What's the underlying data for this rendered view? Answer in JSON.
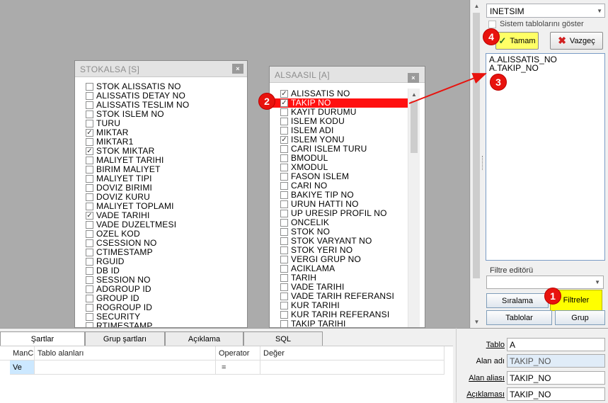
{
  "stokalsa": {
    "title": "STOKALSA [S]",
    "close": "×",
    "fields": [
      {
        "name": "STOK ALISSATIS NO",
        "checked": false
      },
      {
        "name": "ALISSATIS DETAY NO",
        "checked": false
      },
      {
        "name": "ALISSATIS TESLIM NO",
        "checked": false
      },
      {
        "name": "STOK ISLEM NO",
        "checked": false
      },
      {
        "name": "TURU",
        "checked": false
      },
      {
        "name": "MIKTAR",
        "checked": true
      },
      {
        "name": "MIKTAR1",
        "checked": false
      },
      {
        "name": "STOK MIKTAR",
        "checked": true
      },
      {
        "name": "MALIYET TARIHI",
        "checked": false
      },
      {
        "name": "BIRIM MALIYET",
        "checked": false
      },
      {
        "name": "MALIYET TIPI",
        "checked": false
      },
      {
        "name": "DOVIZ BIRIMI",
        "checked": false
      },
      {
        "name": "DOVIZ KURU",
        "checked": false
      },
      {
        "name": "MALIYET TOPLAMI",
        "checked": false
      },
      {
        "name": "VADE TARIHI",
        "checked": true
      },
      {
        "name": "VADE DUZELTMESI",
        "checked": false
      },
      {
        "name": "OZEL KOD",
        "checked": false
      },
      {
        "name": "CSESSION NO",
        "checked": false
      },
      {
        "name": "CTIMESTAMP",
        "checked": false
      },
      {
        "name": "RGUID",
        "checked": false
      },
      {
        "name": "DB ID",
        "checked": false
      },
      {
        "name": "SESSION NO",
        "checked": false
      },
      {
        "name": "ADGROUP ID",
        "checked": false
      },
      {
        "name": "GROUP ID",
        "checked": false
      },
      {
        "name": "ROGROUP ID",
        "checked": false
      },
      {
        "name": "SECURITY",
        "checked": false
      },
      {
        "name": "RTIMESTAMP",
        "checked": false
      }
    ]
  },
  "alsaasil": {
    "title": "ALSAASIL [A]",
    "close": "×",
    "fields": [
      {
        "name": "ALISSATIS NO",
        "checked": true
      },
      {
        "name": "TAKIP NO",
        "checked": true,
        "highlighted": true
      },
      {
        "name": "KAYIT DURUMU",
        "checked": false
      },
      {
        "name": "ISLEM KODU",
        "checked": false
      },
      {
        "name": "ISLEM ADI",
        "checked": false
      },
      {
        "name": "ISLEM YONU",
        "checked": true
      },
      {
        "name": "CARI ISLEM TURU",
        "checked": false
      },
      {
        "name": "BMODUL",
        "checked": false
      },
      {
        "name": "XMODUL",
        "checked": false
      },
      {
        "name": "FASON ISLEM",
        "checked": false
      },
      {
        "name": "CARI NO",
        "checked": false
      },
      {
        "name": "BAKIYE TIP NO",
        "checked": false
      },
      {
        "name": "URUN HATTI NO",
        "checked": false
      },
      {
        "name": "UP URESIP PROFIL NO",
        "checked": false
      },
      {
        "name": "ONCELIK",
        "checked": false
      },
      {
        "name": "STOK NO",
        "checked": false
      },
      {
        "name": "STOK VARYANT NO",
        "checked": false
      },
      {
        "name": "STOK YERI NO",
        "checked": false
      },
      {
        "name": "VERGI GRUP NO",
        "checked": false
      },
      {
        "name": "ACIKLAMA",
        "checked": false
      },
      {
        "name": "TARIH",
        "checked": false
      },
      {
        "name": "VADE TARIHI",
        "checked": false
      },
      {
        "name": "VADE TARIH REFERANSI",
        "checked": false
      },
      {
        "name": "KUR TARIHI",
        "checked": false
      },
      {
        "name": "KUR TARIH REFERANSI",
        "checked": false
      },
      {
        "name": "TAKIP TARIHI",
        "checked": false
      }
    ]
  },
  "annotations": [
    "1",
    "2",
    "3",
    "4"
  ],
  "right_panel": {
    "database": "INETSIM",
    "show_system_tables": "Sistem tablolarını göster",
    "ok_button": "Tamam",
    "cancel_button": "Vazgeç",
    "selected_fields": [
      "A.ALISSATIS_NO",
      "A.TAKIP_NO"
    ],
    "filter_editor_label": "Filtre editörü",
    "buttons": {
      "sort": "Sıralama",
      "filters": "Filtreler",
      "tables": "Tablolar",
      "group": "Grup"
    }
  },
  "bottom": {
    "tabs": [
      {
        "label": "Şartlar",
        "active": true
      },
      {
        "label": "Grup şartları",
        "active": false
      },
      {
        "label": "Açıklama",
        "active": false
      },
      {
        "label": "SQL",
        "active": false
      }
    ],
    "grid": {
      "headers": [
        "ManC",
        "Tablo alanları",
        "Operator",
        "Değer"
      ],
      "rows": [
        [
          "Ve",
          "",
          "=",
          ""
        ]
      ]
    }
  },
  "properties": {
    "tablo": {
      "label": "Tablo",
      "value": "A"
    },
    "alan_adi": {
      "label": "Alan adı",
      "value": "TAKIP_NO"
    },
    "alan_aliasi": {
      "label": "Alan aliası",
      "value": "TAKIP_NO"
    },
    "aciklamasi": {
      "label": "Açıklaması",
      "value": "TAKIP_NO"
    }
  },
  "colors": {
    "highlight": "#ff1010",
    "annotation": "#e8130e",
    "accent_yellow": "#ffff66"
  }
}
